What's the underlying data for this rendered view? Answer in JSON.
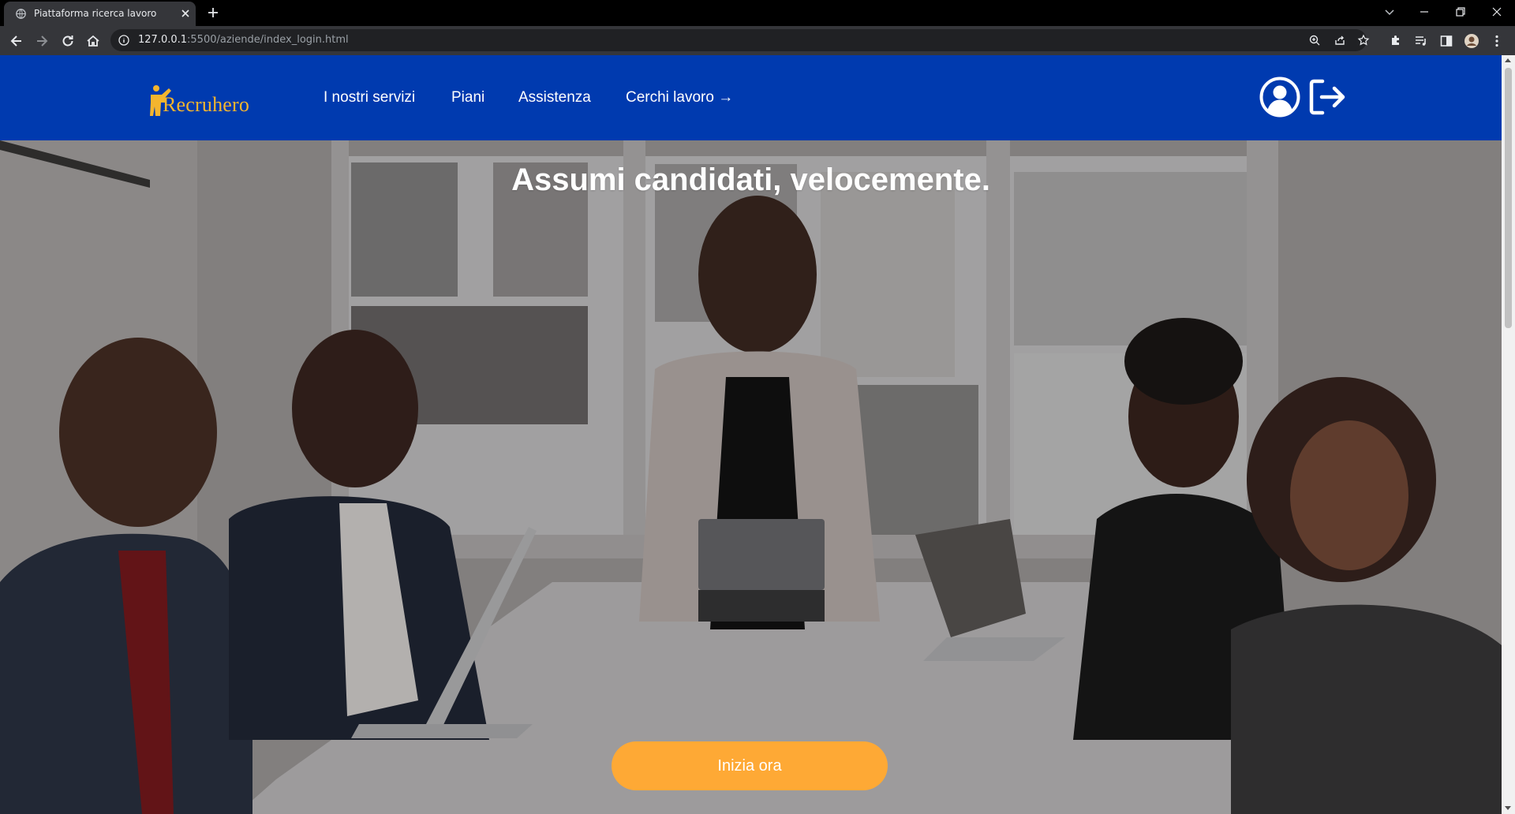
{
  "browser": {
    "tab_title": "Piattaforma ricerca lavoro",
    "url_host": "127.0.0.1",
    "url_rest": ":5500/aziende/index_login.html"
  },
  "navbar": {
    "brand": "Recruhero",
    "links": [
      "I nostri servizi",
      "Piani",
      "Assistenza",
      "Cerchi lavoro →"
    ],
    "brand_color": "#003aaf",
    "logo_color": "#f4b52e"
  },
  "hero": {
    "title": "Assumi candidati, velocemente.",
    "cta_label": "Inizia ora",
    "cta_color": "#fea935"
  },
  "icons": {
    "account": "user-circle-icon",
    "logout": "logout-icon"
  }
}
